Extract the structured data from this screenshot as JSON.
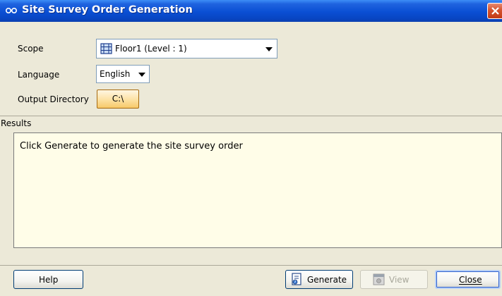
{
  "window": {
    "title": "Site Survey Order Generation",
    "title_bar_color": "#0a4fd4",
    "app_icon": "glasses-icon",
    "close_icon": "close-icon"
  },
  "form": {
    "scope_label": "Scope",
    "scope_value": "Floor1 (Level : 1)",
    "scope_icon": "floor-icon",
    "language_label": "Language",
    "language_value": "English",
    "output_dir_label": "Output Directory",
    "output_dir_value": "C:\\"
  },
  "results": {
    "label": "Results",
    "message": "Click Generate to generate the site survey order",
    "background_color": "#fffde8"
  },
  "buttons": {
    "help": "Help",
    "generate": "Generate",
    "generate_icon": "generate-report-icon",
    "view": "View",
    "view_icon": "view-icon",
    "close": "Close"
  }
}
